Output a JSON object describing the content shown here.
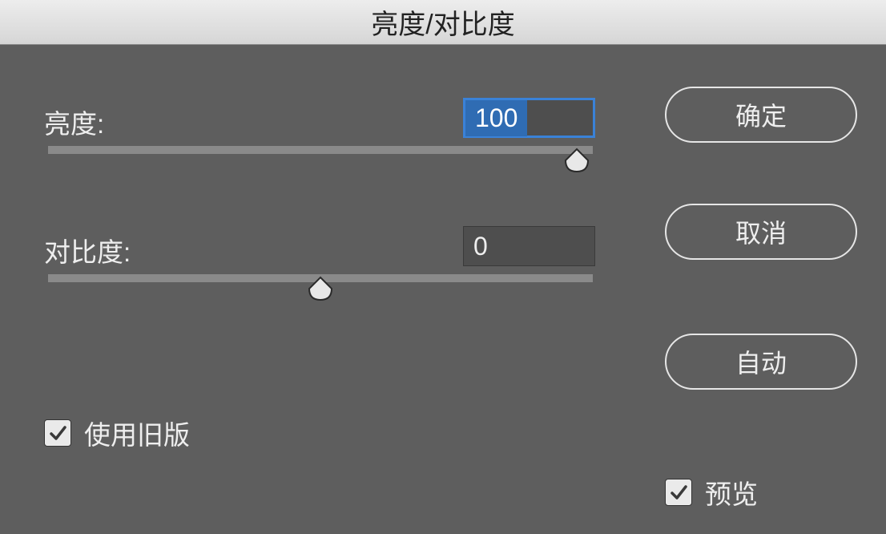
{
  "title": "亮度/对比度",
  "brightness": {
    "label": "亮度:",
    "value": "100"
  },
  "contrast": {
    "label": "对比度:",
    "value": "0"
  },
  "buttons": {
    "ok": "确定",
    "cancel": "取消",
    "auto": "自动"
  },
  "checkboxes": {
    "use_legacy": {
      "label": "使用旧版",
      "checked": true
    },
    "preview": {
      "label": "预览",
      "checked": true
    }
  }
}
